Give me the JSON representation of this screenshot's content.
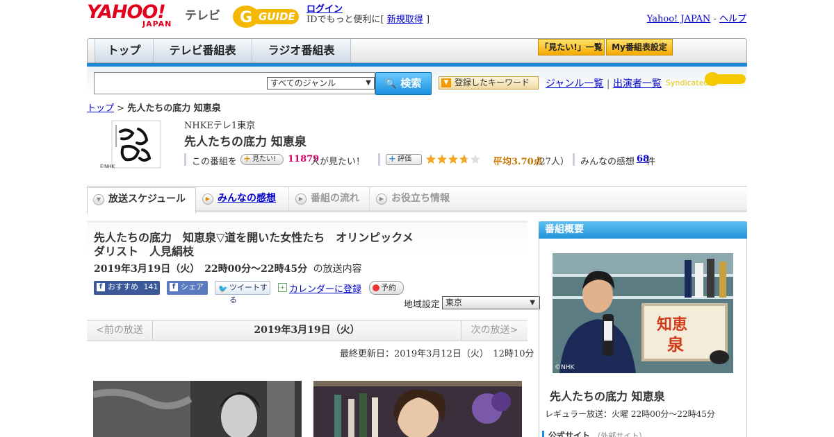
{
  "header": {
    "logo_yahoo": "YAHOO!",
    "logo_japan": "JAPAN",
    "logo_tv": "テレビ",
    "logo_gguide": "GUIDE",
    "login_label": "ログイン",
    "login_sub_prefix": "IDでもっと便利に[",
    "signup_label": "新規取得",
    "login_sub_suffix": "]",
    "yahoo_japan_link": "Yahoo! JAPAN",
    "separator": " - ",
    "help_link": "ヘルプ"
  },
  "tabs": {
    "top": "トップ",
    "tv_listing": "テレビ番組表",
    "radio_listing": "ラジオ番組表",
    "mitai_list": "「見たい!」一覧",
    "my_listing": "My番組表設定"
  },
  "search": {
    "genre_selected": "すべてのジャンル",
    "button_label": "検索",
    "keyword_button": "登録したキーワード",
    "genre_list_link": "ジャンル一覧",
    "link_separator": "|",
    "cast_list_link": "出演者一覧",
    "syndicated": "Syndicated"
  },
  "breadcrumb": {
    "top": "トップ",
    "sep": " > ",
    "current": "先人たちの底力 知恵泉"
  },
  "program": {
    "thumb_credit": "©NHK",
    "channel": "NHKEテレ1東京",
    "title": "先人たちの底力 知恵泉",
    "want_prefix": "この番組を",
    "want_button": "見たい!",
    "want_count": "11879",
    "want_suffix": "人が見たい！",
    "rate_button": "評価",
    "rating_prefix": "（",
    "rating_avg": "平均3.70点",
    "rating_count": "/27人）",
    "rating_value": 3.7,
    "rating_max": 5,
    "kanso_prefix": "みんなの感想",
    "kanso_count": "68",
    "kanso_suffix": "件"
  },
  "subtabs": {
    "schedule": "放送スケジュール",
    "kanso": "みんなの感想",
    "flow": "番組の流れ",
    "help": "お役立ち情報"
  },
  "episode": {
    "title": "先人たちの底力　知恵泉▽道を開いた女性たち　オリンピックメダリスト　人見絹枝",
    "date": "2019年3月19日（火）　22時00分～22時45分",
    "date_suffix": "の放送内容",
    "fb_like": "おすすめ",
    "fb_like_count": "141",
    "fb_share": "シェア",
    "tweet": "ツイートする",
    "calendar": "カレンダーに登録",
    "reserve": "予約",
    "region_label": "地域設定",
    "region_selected": "東京"
  },
  "datenav": {
    "prev": "<前の放送",
    "current": "2019年3月19日（火）",
    "next": "次の放送>"
  },
  "updated": "最終更新日：2019年3月12日（火）　12時10分",
  "sidebar": {
    "heading": "番組概要",
    "photo_credit": "©NHK",
    "title": "先人たちの底力 知恵泉",
    "regular": "レギュラー放送：火曜 22時00分～22時45分",
    "official": "公式サイト",
    "official_note": "（外部サイト）"
  },
  "colors": {
    "brand_red": "#e4001c",
    "accent_blue": "#1a8ad6",
    "gguide_yellow": "#f5b800",
    "want_pink": "#d4006a",
    "rating_orange": "#c87800",
    "star": "#f5a623"
  }
}
